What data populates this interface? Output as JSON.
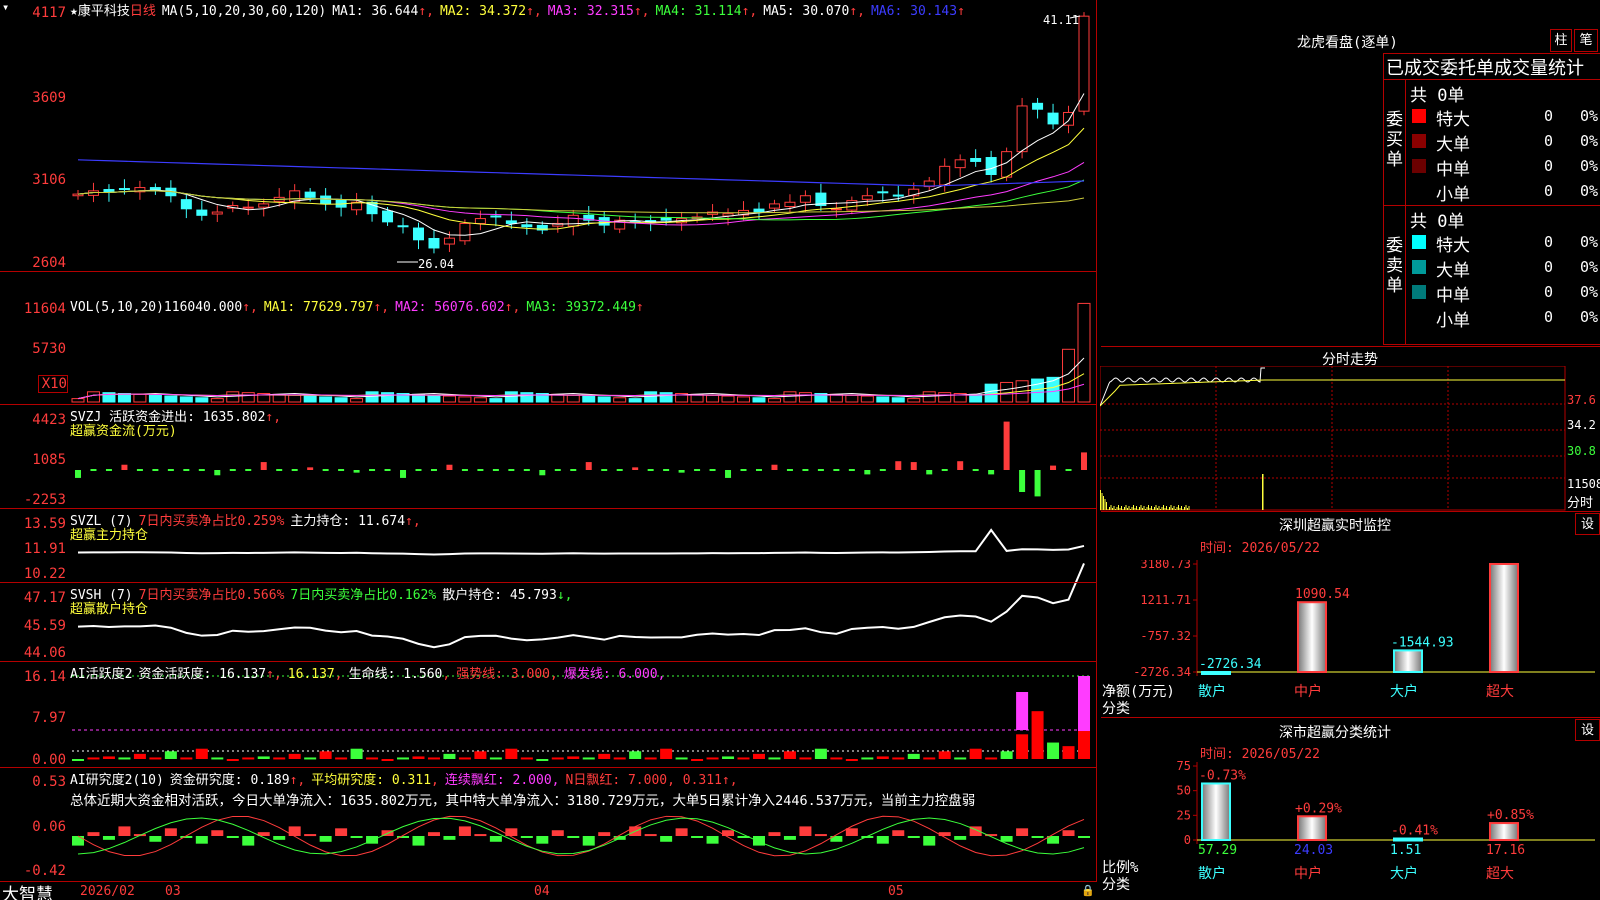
{
  "window": {
    "title": "康平科技",
    "period": "日线",
    "star": "★",
    "dropdown": "▾",
    "brand": "大智慧"
  },
  "colors": {
    "up": "#ff3c3c",
    "down": "#3cffff",
    "border": "#b40000",
    "ma1": "#ffffff",
    "ma2": "#ffff3c",
    "ma3": "#ff3cff",
    "ma4": "#3cff3c",
    "ma5": "#ffff3c",
    "ma6": "#3c3cff"
  },
  "price_panel": {
    "header": {
      "ma_spec": "MA(5,10,20,30,60,120)",
      "items": [
        {
          "label": "MA1:",
          "value": "36.644",
          "arrow": "↑",
          "color": "#ffffff"
        },
        {
          "label": "MA2:",
          "value": "34.372",
          "arrow": "↑",
          "color": "#ffff3c"
        },
        {
          "label": "MA3:",
          "value": "32.315",
          "arrow": "↑",
          "color": "#ff3cff"
        },
        {
          "label": "MA4:",
          "value": "31.114",
          "arrow": "↑",
          "color": "#3cff3c"
        },
        {
          "label": "MA5:",
          "value": "30.070",
          "arrow": "↑",
          "color": "#ffffff"
        },
        {
          "label": "MA6:",
          "value": "30.143",
          "arrow": "↑",
          "color": "#3c3cff"
        }
      ]
    },
    "yticks": [
      "4117",
      "3609",
      "3106",
      "2604"
    ],
    "high_label": "41.11",
    "low_label": "26.04"
  },
  "vol_panel": {
    "header": {
      "spec": "VOL(5,10,20)",
      "vol": "116040.000",
      "ma1": "MA1: 77629.797",
      "ma2": "MA2: 56076.602",
      "ma3": "MA3: 39372.449"
    },
    "yticks": [
      "11604",
      "5730",
      "X10"
    ]
  },
  "svzj_panel": {
    "line1": "SVZJ  活跃资金进出: 1635.802",
    "line2": "超赢资金流(万元)",
    "yticks": [
      "4423",
      "1085",
      "-2253"
    ]
  },
  "svzl_panel": {
    "line1a": "SVZL (7)",
    "line1b": "7日内买卖净占比0.259%",
    "line1c": "主力持仓: 11.674",
    "line2": "超赢主力持仓",
    "yticks": [
      "13.59",
      "11.91",
      "10.22"
    ]
  },
  "svsh_panel": {
    "line1a": "SVSH (7)",
    "line1b": "7日内买卖净占比0.566%",
    "line1c": "7日内买卖净占比0.162%",
    "line1d": "散户持仓: 45.793",
    "line2": "超赢散户持仓",
    "yticks": [
      "47.17",
      "45.59",
      "44.06"
    ]
  },
  "ai_panel": {
    "line1a": "AI活跃度2",
    "line1b": "资金活跃度: 16.137",
    "line1c": "16.137",
    "line1d": "生命线: 1.560",
    "line1e": "强势线: 3.000",
    "line1f": "爆发线: 6.000",
    "yticks": [
      "16.14",
      "7.97",
      "0.00"
    ]
  },
  "res_panel": {
    "line1a": "AI研究度2(10)",
    "line1b": "资金研究度: 0.189",
    "line1c": "平均研究度: 0.311",
    "line1d": "连续飘红: 2.000",
    "line1e": "N日飘红: 7.000, 0.311",
    "line2": "总体近期大资金相对活跃，今日大单净流入：1635.802万元，其中特大单净流入：3180.729万元，大单5日累计净入2446.537万元，当前主力控盘弱",
    "yticks": [
      "0.53",
      "0.06",
      "-0.42"
    ]
  },
  "xaxis": {
    "labels": [
      "2026/02",
      "03",
      "04",
      "05"
    ]
  },
  "longhu": {
    "title": "龙虎看盘(逐单)",
    "btn_zhu": "柱",
    "btn_bi": "笔",
    "subtitle": "已成交委托单成交量统计",
    "buy_label": "委买单",
    "buy_total": "共 0单",
    "sell_label": "委卖单",
    "sell_total": "共 0单",
    "rows_buy": [
      {
        "name": "特大",
        "count": "0",
        "pct": "0%",
        "color": "#ff0000"
      },
      {
        "name": "大单",
        "count": "0",
        "pct": "0%",
        "color": "#8b0000"
      },
      {
        "name": "中单",
        "count": "0",
        "pct": "0%",
        "color": "#6b0000"
      },
      {
        "name": "小单",
        "count": "0",
        "pct": "0%",
        "color": ""
      }
    ],
    "rows_sell": [
      {
        "name": "特大",
        "count": "0",
        "pct": "0%",
        "color": "#00ffff"
      },
      {
        "name": "大单",
        "count": "0",
        "pct": "0%",
        "color": "#009a9a"
      },
      {
        "name": "中单",
        "count": "0",
        "pct": "0%",
        "color": "#007a7a"
      },
      {
        "name": "小单",
        "count": "0",
        "pct": "0%",
        "color": ""
      }
    ]
  },
  "fenshi": {
    "title": "分时走势",
    "yticks": [
      "37.6",
      "34.2",
      "30.8",
      "11508"
    ],
    "xlabel": "分时"
  },
  "sz_monitor": {
    "title": "深圳超赢实时监控",
    "btn": "设",
    "time": "时间: 2026/05/22",
    "yticks": [
      "3180.73",
      "1211.71",
      "-757.32",
      "-2726.34"
    ],
    "ylabel1": "净额(万元)",
    "ylabel2": "分类",
    "bars": [
      {
        "cat": "散户",
        "value": -2726.34,
        "label": "-2726.34"
      },
      {
        "cat": "中户",
        "value": 1090.54,
        "label": "1090.54"
      },
      {
        "cat": "大户",
        "value": -1544.93,
        "label": "-1544.93"
      },
      {
        "cat": "超大",
        "value": 3180.73,
        "label": "3180.73"
      }
    ]
  },
  "sz_class": {
    "title": "深市超赢分类统计",
    "btn": "设",
    "time": "时间: 2026/05/22",
    "yticks": [
      "75",
      "50",
      "25",
      "0"
    ],
    "ylabel1": "比例%",
    "ylabel2": "分类",
    "bars": [
      {
        "cat": "散户",
        "value": 57.29,
        "label": "57.29",
        "chg": "-0.73%"
      },
      {
        "cat": "中户",
        "value": 24.03,
        "label": "24.03",
        "chg": "+0.29%"
      },
      {
        "cat": "大户",
        "value": 1.51,
        "label": "1.51",
        "chg": "-0.41%"
      },
      {
        "cat": "超大",
        "value": 17.16,
        "label": "17.16",
        "chg": "+0.85%"
      }
    ]
  },
  "chart_data": {
    "type": "line",
    "title": "康平科技 日线",
    "x": [
      "2026/02",
      "03",
      "04",
      "05"
    ],
    "ylim": [
      26.04,
      41.11
    ],
    "series": [
      {
        "name": "close",
        "values": [
          30.2,
          30.4,
          30.3,
          30.5,
          30.6,
          30.4,
          30.1,
          29.3,
          28.9,
          29.1,
          29.5,
          29.4,
          29.6,
          30.0,
          30.4,
          30.0,
          29.6,
          29.4,
          29.7,
          29.0,
          28.5,
          28.2,
          27.4,
          26.9,
          27.5,
          28.4,
          28.7,
          28.8,
          28.4,
          28.2,
          28.0,
          28.4,
          28.9,
          28.6,
          28.3,
          28.6,
          28.5,
          28.5,
          28.6,
          28.7,
          28.8,
          29.1,
          29.0,
          29.2,
          29.1,
          29.6,
          29.7,
          30.1,
          29.5,
          29.3,
          29.8,
          30.1,
          30.3,
          30.1,
          30.5,
          31.0,
          31.9,
          32.3,
          32.2,
          31.4,
          32.8,
          35.6,
          35.4,
          34.5,
          35.2,
          41.1
        ]
      },
      {
        "name": "MA1",
        "values": [
          36.644
        ]
      },
      {
        "name": "MA2",
        "values": [
          34.372
        ]
      },
      {
        "name": "MA3",
        "values": [
          32.315
        ]
      },
      {
        "name": "MA4",
        "values": [
          31.114
        ]
      },
      {
        "name": "MA5",
        "values": [
          30.07
        ]
      },
      {
        "name": "MA6",
        "values": [
          30.143
        ]
      }
    ]
  }
}
